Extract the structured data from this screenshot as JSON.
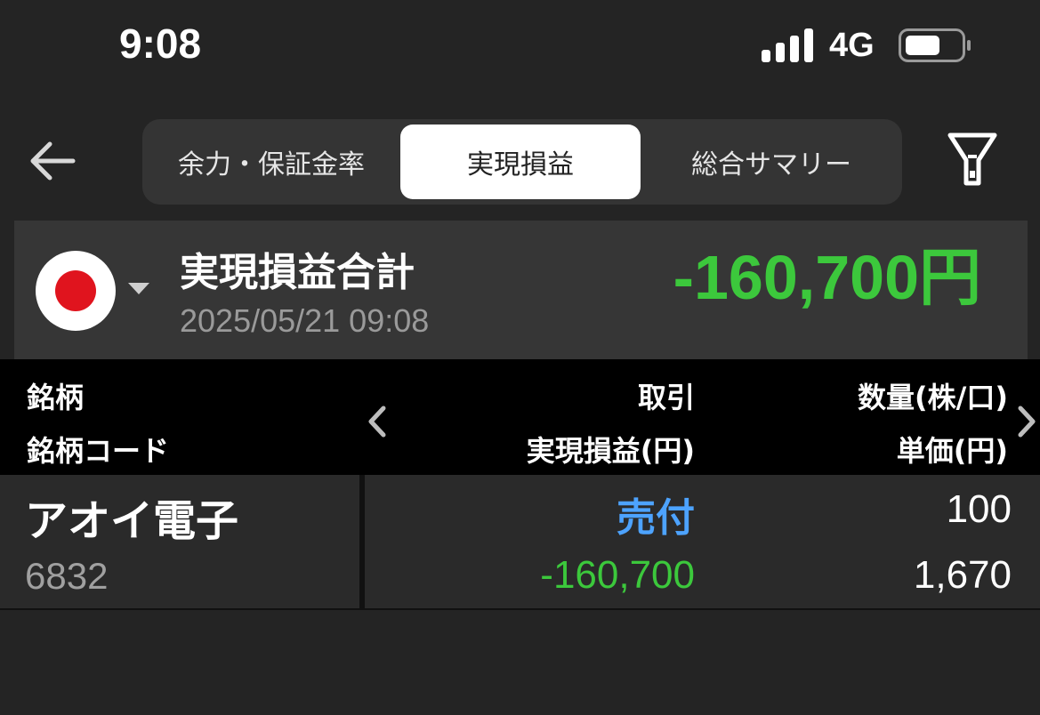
{
  "status_bar": {
    "time": "9:08",
    "network": "4G",
    "signal_icon": "signal-bars-icon",
    "battery_icon": "battery-icon"
  },
  "header": {
    "back_icon": "back-arrow-icon",
    "tabs": [
      {
        "label": "余力・保証金率",
        "selected": false
      },
      {
        "label": "実現損益",
        "selected": true
      },
      {
        "label": "総合サマリー",
        "selected": false
      }
    ],
    "filter_icon": "filter-icon"
  },
  "summary": {
    "market_flag": "japan-flag-icon",
    "title": "実現損益合計",
    "datetime": "2025/05/21 09:08",
    "total": "-160,700円",
    "total_color": "#3cc83c"
  },
  "table": {
    "headers": {
      "col1_line1": "銘柄",
      "col1_line2": "銘柄コード",
      "col2_line1": "取引",
      "col2_line2": "実現損益(円)",
      "col3_line1": "数量(株/口)",
      "col3_line2": "単価(円)"
    },
    "rows": [
      {
        "name": "アオイ電子",
        "code": "6832",
        "trade": "売付",
        "pnl": "-160,700",
        "quantity": "100",
        "unit_price": "1,670"
      }
    ],
    "colors": {
      "sell": "#4da3ff",
      "loss": "#3cc83c"
    }
  }
}
